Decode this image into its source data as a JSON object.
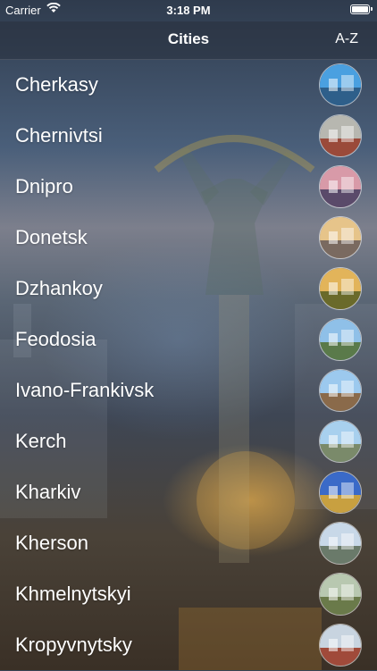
{
  "status_bar": {
    "carrier": "Carrier",
    "time": "3:18 PM"
  },
  "navbar": {
    "title": "Cities",
    "sort_button": "A-Z"
  },
  "cities": [
    {
      "name": "Cherkasy",
      "thumb_sky": "#4aa0e0",
      "thumb_ground": "#2e5f8a"
    },
    {
      "name": "Chernivtsi",
      "thumb_sky": "#b7b7b0",
      "thumb_ground": "#9a4a3a"
    },
    {
      "name": "Dnipro",
      "thumb_sky": "#d89aa8",
      "thumb_ground": "#5a4a6a"
    },
    {
      "name": "Donetsk",
      "thumb_sky": "#e6c48a",
      "thumb_ground": "#7a6a60"
    },
    {
      "name": "Dzhankoy",
      "thumb_sky": "#e2b45a",
      "thumb_ground": "#6a6a2a"
    },
    {
      "name": "Feodosia",
      "thumb_sky": "#8fc0e8",
      "thumb_ground": "#5a7a4a"
    },
    {
      "name": "Ivano-Frankivsk",
      "thumb_sky": "#9cc9ee",
      "thumb_ground": "#8a6a4a"
    },
    {
      "name": "Kerch",
      "thumb_sky": "#a8d0ee",
      "thumb_ground": "#7a8a6a"
    },
    {
      "name": "Kharkiv",
      "thumb_sky": "#3a6ac8",
      "thumb_ground": "#c8a040"
    },
    {
      "name": "Kherson",
      "thumb_sky": "#c8d8e8",
      "thumb_ground": "#6a7a6a"
    },
    {
      "name": "Khmelnytskyi",
      "thumb_sky": "#b8c8b0",
      "thumb_ground": "#6a7a4a"
    },
    {
      "name": "Kropyvnytsky",
      "thumb_sky": "#c8d4e0",
      "thumb_ground": "#a04a3a"
    }
  ]
}
